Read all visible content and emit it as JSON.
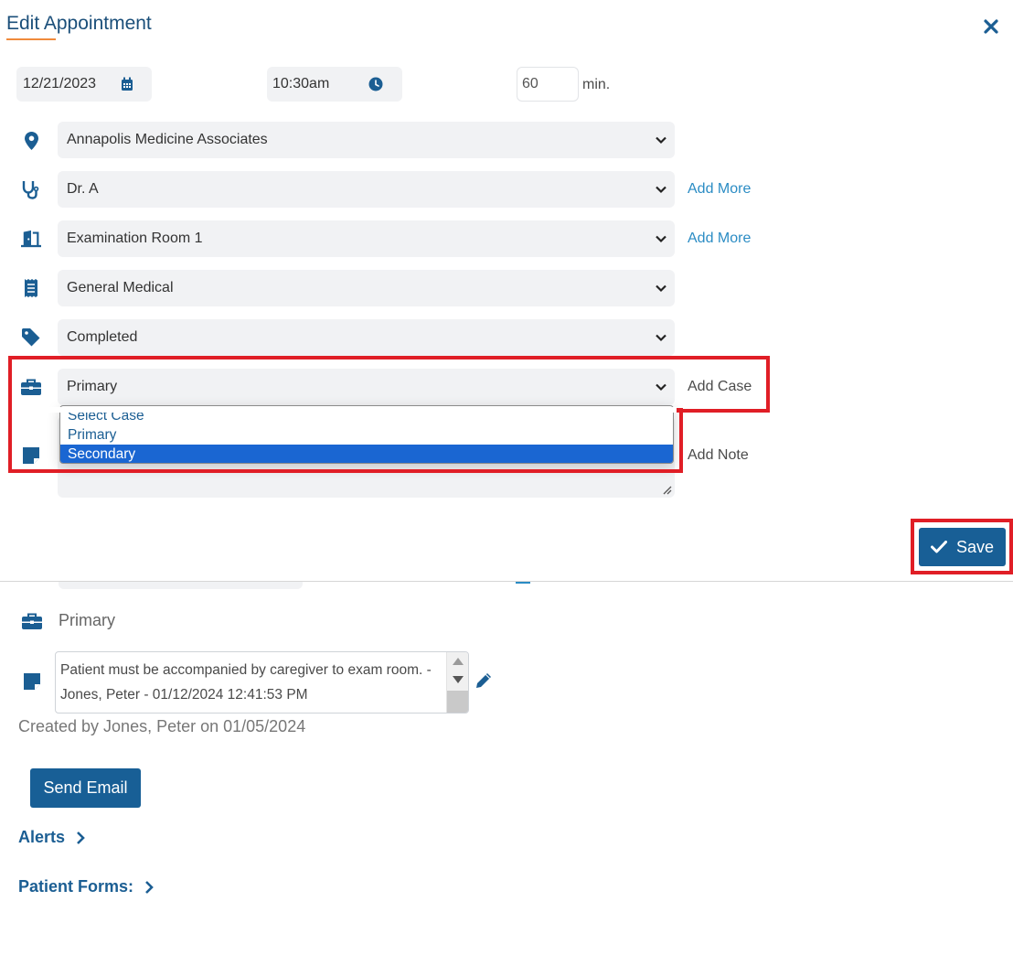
{
  "dialog": {
    "title": "Edit Appointment",
    "close_icon": "close-icon"
  },
  "schedule": {
    "date_value": "12/21/2023",
    "time_value": "10:30am",
    "duration_value": "60",
    "duration_unit": "min."
  },
  "fields": {
    "location": {
      "icon": "location-pin-icon",
      "value": "Annapolis Medicine Associates"
    },
    "provider": {
      "icon": "stethoscope-icon",
      "value": "Dr. A",
      "action": "Add More"
    },
    "room": {
      "icon": "room-door-icon",
      "value": "Examination Room 1",
      "action": "Add More"
    },
    "visit_type": {
      "icon": "receipt-icon",
      "value": "General Medical"
    },
    "status": {
      "icon": "tag-icon",
      "value": "Completed"
    },
    "case": {
      "icon": "briefcase-icon",
      "value": "Primary",
      "action": "Add Case"
    },
    "note": {
      "icon": "sticky-note-icon",
      "action": "Add Note"
    }
  },
  "case_dropdown": {
    "options": [
      "Select Case",
      "Primary",
      "Secondary"
    ],
    "highlighted": "Secondary"
  },
  "save_button": {
    "label": "Save"
  },
  "details": {
    "case_label": "Primary",
    "note_text": "Patient must be accompanied by caregiver to exam room. - Jones, Peter - 01/12/2024 12:41:53 PM",
    "created_by": "Created by Jones, Peter on 01/05/2024",
    "send_email_label": "Send Email",
    "alerts_label": "Alerts",
    "patient_forms_label": "Patient Forms:"
  },
  "colors": {
    "primary": "#185f96",
    "link": "#2b8cc4",
    "highlight": "#e01e26",
    "selected_option": "#1a66d2"
  }
}
